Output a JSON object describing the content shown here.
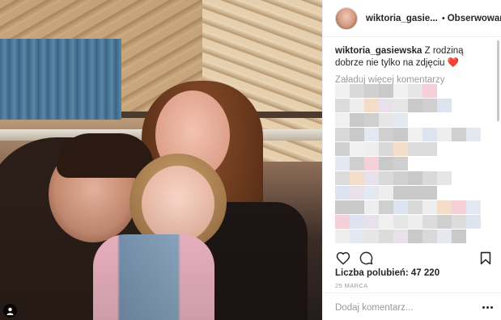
{
  "post": {
    "username": "wiktoria_gasie...",
    "follow_label": "Obserwowanie",
    "separator": "•"
  },
  "caption": {
    "username": "wiktoria_gasiewska",
    "text": " Z rodziną dobrze nie tylko na zdjęciu ",
    "emoji": "❤️"
  },
  "comments": {
    "load_more": "Załaduj więcej komentarzy"
  },
  "actions": {
    "icons": [
      "heart-icon",
      "comment-icon",
      "bookmark-icon"
    ]
  },
  "likes": {
    "text": "Liczba polubień: 47 220"
  },
  "date": "25 MARCA",
  "comment_box": {
    "placeholder": "Dodaj komentarz..."
  },
  "colors": {
    "heart": "#e0232e",
    "muted": "#999999"
  }
}
